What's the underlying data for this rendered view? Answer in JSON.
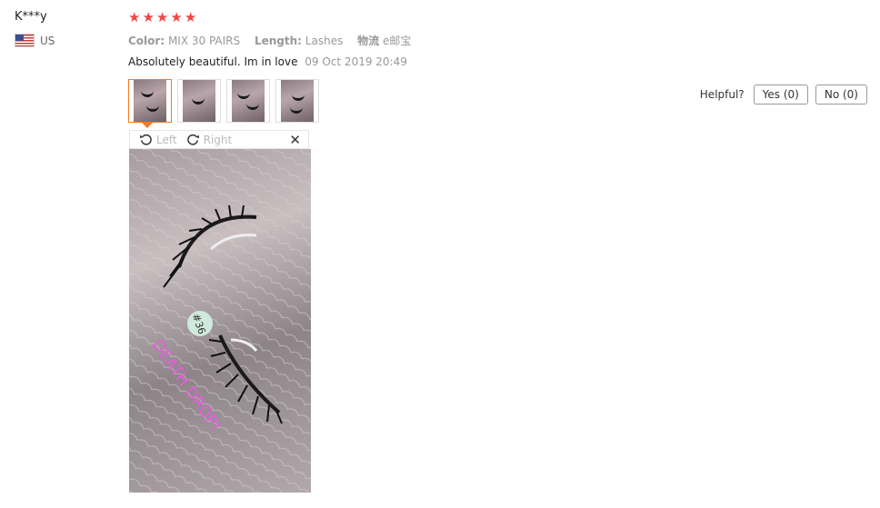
{
  "user": {
    "name": "K***y",
    "country": "US"
  },
  "rating": 5,
  "attributes": [
    {
      "name": "Color:",
      "value": "MIX 30 PAIRS"
    },
    {
      "name": "Length:",
      "value": "Lashes"
    },
    {
      "name": "物流",
      "value": "e邮宝"
    }
  ],
  "review": {
    "text": "Absolutely beautiful. Im in love",
    "date": "09 Oct 2019 20:49"
  },
  "viewer": {
    "left_label": "Left",
    "right_label": "Right",
    "close_symbol": "✕"
  },
  "photo_caption": {
    "number_tag": "#36",
    "text": "DEATH DROP!"
  },
  "helpful": {
    "label": "Helpful?",
    "yes_label": "Yes (0)",
    "no_label": "No (0)"
  },
  "colors": {
    "star": "#f04646",
    "accent": "#f47a25",
    "caption": "#e85ce0"
  },
  "icons": [
    "us-flag-icon",
    "star-icon",
    "rotate-left-icon",
    "rotate-right-icon",
    "close-icon"
  ]
}
